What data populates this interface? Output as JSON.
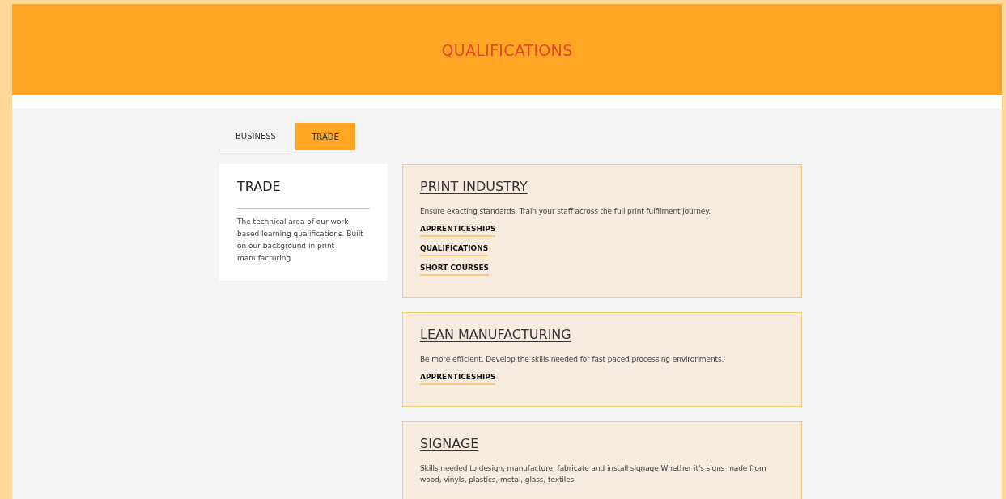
{
  "header": {
    "title": "QUALIFICATIONS"
  },
  "tabs": [
    {
      "label": "BUSINESS",
      "selected": false
    },
    {
      "label": "TRADE",
      "selected": true
    }
  ],
  "intro": {
    "title": "TRADE",
    "text": "The technical area of our work based learning qualifications. Built on our background in print manufacturing"
  },
  "sectors": [
    {
      "title": "PRINT INDUSTRY",
      "text": "Ensure exacting standards. Train your staff across the full print fulfilment journey.",
      "links": [
        "APPRENTICESHIPS",
        "QUALIFICATIONS",
        "SHORT COURSES"
      ]
    },
    {
      "title": "LEAN MANUFACTURING",
      "text": "Be more efficient. Develop the skills needed for fast paced processing environments.",
      "links": [
        "APPRENTICESHIPS"
      ]
    },
    {
      "title": "SIGNAGE",
      "text": "Skills needed to design, manufacture, fabricate and install signage  Whether it's signs made from wood, vinyls, plastics, metal, glass, textiles"
    }
  ]
}
